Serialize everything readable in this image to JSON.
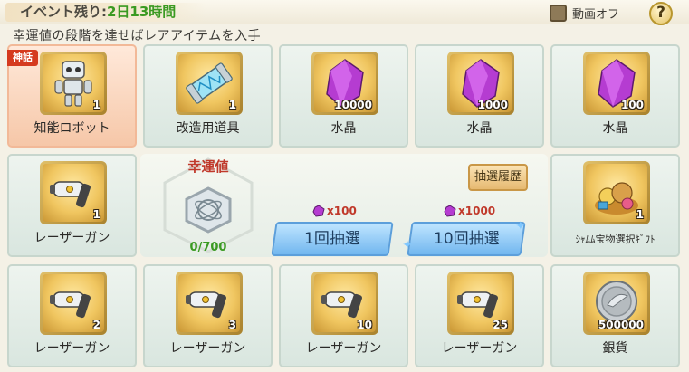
{
  "header": {
    "event_label": "イベント残り:",
    "event_value": "2日13時間",
    "video_toggle_label": "動画オフ",
    "help_label": "?"
  },
  "subtitle": "幸運値の段階を達せばレアアイテムを入手",
  "row1": [
    {
      "name": "知能ロボット",
      "qty": "1",
      "tag": "神話",
      "icon": "robot-icon"
    },
    {
      "name": "改造用道具",
      "qty": "1",
      "icon": "capsule-icon"
    },
    {
      "name": "水晶",
      "qty": "10000",
      "icon": "crystal-icon"
    },
    {
      "name": "水晶",
      "qty": "1000",
      "icon": "crystal-icon"
    },
    {
      "name": "水晶",
      "qty": "100",
      "icon": "crystal-icon"
    }
  ],
  "row2_left": {
    "name": "レーザーガン",
    "qty": "1",
    "icon": "laser-gun-icon"
  },
  "row2_right": {
    "name": "ｼｬﾑﾑ宝物選択ｷﾞﾌﾄ",
    "qty": "1",
    "icon": "treasure-gift-icon"
  },
  "luck": {
    "title": "幸運値",
    "value": "0/700"
  },
  "history_button": "抽選履歴",
  "draw_once": {
    "cost": "x100",
    "label": "1回抽選"
  },
  "draw_ten": {
    "cost": "x1000",
    "label": "10回抽選"
  },
  "row3": [
    {
      "name": "レーザーガン",
      "qty": "2",
      "icon": "laser-gun-icon"
    },
    {
      "name": "レーザーガン",
      "qty": "3",
      "icon": "laser-gun-icon"
    },
    {
      "name": "レーザーガン",
      "qty": "10",
      "icon": "laser-gun-icon"
    },
    {
      "name": "レーザーガン",
      "qty": "25",
      "icon": "laser-gun-icon"
    },
    {
      "name": "銀貨",
      "qty": "500000",
      "icon": "silver-coin-icon"
    }
  ],
  "colors": {
    "luck_title": "#c0392b",
    "luck_value": "#3a9a22",
    "event_value": "#3a9a22",
    "mythic_tag": "#d53a1f"
  }
}
